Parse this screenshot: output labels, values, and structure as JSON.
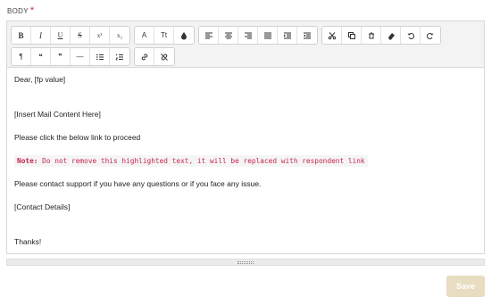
{
  "field": {
    "label": "BODY",
    "required_mark": "*"
  },
  "toolbar": {
    "row1": [
      {
        "name": "bold-button",
        "glyph": "B"
      },
      {
        "name": "italic-button",
        "glyph": "I"
      },
      {
        "name": "underline-button",
        "glyph": "U"
      },
      {
        "name": "strikethrough-button",
        "glyph": "S"
      },
      {
        "name": "superscript-button",
        "glyph": "x²"
      },
      {
        "name": "subscript-button",
        "glyph": "x₂"
      },
      {
        "name": "font-color-button",
        "glyph": "A"
      },
      {
        "name": "font-size-button",
        "glyph": "Tt"
      }
    ],
    "row2": [
      {
        "name": "paragraph-button",
        "glyph": "¶"
      },
      {
        "name": "blockquote-button",
        "glyph": "❝"
      },
      {
        "name": "quote-button",
        "glyph": "❞"
      },
      {
        "name": "horizontal-rule-button",
        "glyph": "—"
      }
    ]
  },
  "content": {
    "greeting": "Dear, [fp value]",
    "mail_placeholder": "[Insert Mail Content Here]",
    "link_prompt": "Please click the below link to proceed",
    "note_label": "Note:",
    "note_text": " Do not remove this highlighted text, it will be replaced with respondent link",
    "support_line": "Please contact support if you have any questions or if you face any issue.",
    "contact_details": "[Contact Details]",
    "sign_off": "Thanks!"
  },
  "actions": {
    "save_label": "Save"
  },
  "colors": {
    "required": "#e0242f",
    "note_text": "#c7254e",
    "save_button_bg": "#e8dcc1"
  }
}
